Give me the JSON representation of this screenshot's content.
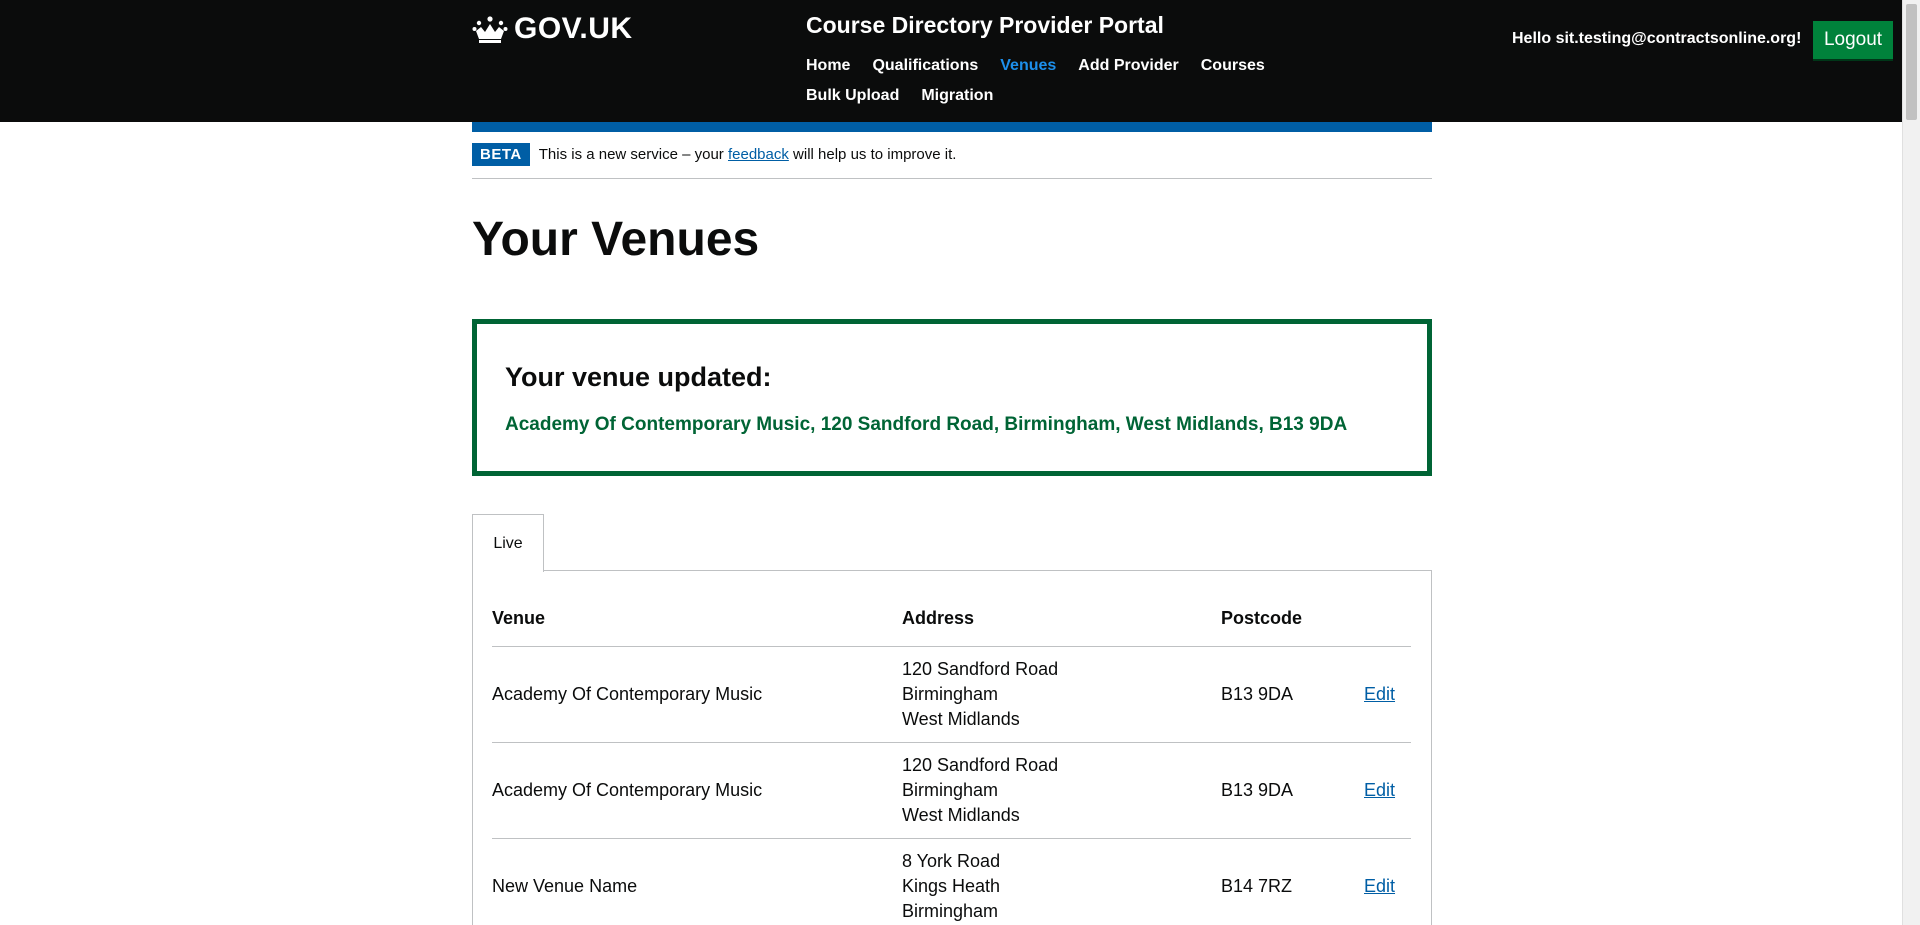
{
  "header": {
    "logo_text": "GOV.UK",
    "service_name": "Course Directory Provider Portal",
    "nav": [
      {
        "label": "Home",
        "active": false
      },
      {
        "label": "Qualifications",
        "active": false
      },
      {
        "label": "Venues",
        "active": true
      },
      {
        "label": "Add Provider",
        "active": false
      },
      {
        "label": "Courses",
        "active": false
      },
      {
        "label": "Bulk Upload",
        "active": false
      },
      {
        "label": "Migration",
        "active": false
      }
    ],
    "greeting": "Hello sit.testing@contractsonline.org!",
    "logout_label": "Logout"
  },
  "beta": {
    "tag": "BETA",
    "text_before": "This is a new service – your ",
    "link": "feedback",
    "text_after": " will help us to improve it."
  },
  "page": {
    "title": "Your Venues"
  },
  "confirmation": {
    "title": "Your venue updated:",
    "body": "Academy Of Contemporary Music, 120 Sandford Road, Birmingham, West Midlands, B13 9DA"
  },
  "tabs": [
    {
      "label": "Live",
      "selected": true
    }
  ],
  "table": {
    "headers": {
      "venue": "Venue",
      "address": "Address",
      "postcode": "Postcode"
    },
    "rows": [
      {
        "venue": "Academy Of Contemporary Music",
        "address": [
          "120 Sandford Road",
          "Birmingham",
          "West Midlands"
        ],
        "postcode": "B13 9DA",
        "action": "Edit"
      },
      {
        "venue": "Academy Of Contemporary Music",
        "address": [
          "120 Sandford Road",
          "Birmingham",
          "West Midlands"
        ],
        "postcode": "B13 9DA",
        "action": "Edit"
      },
      {
        "venue": "New Venue Name",
        "address": [
          "8 York Road",
          "Kings Heath",
          "Birmingham"
        ],
        "postcode": "B14 7RZ",
        "action": "Edit"
      }
    ]
  },
  "colors": {
    "header_bg": "#0b0c0c",
    "active_nav": "#1d8feb",
    "logout_bg": "#00823b",
    "beta_blue": "#005ea5",
    "success_green": "#006435",
    "link": "#005ea5"
  },
  "icons": {
    "logo": "crown-icon"
  }
}
